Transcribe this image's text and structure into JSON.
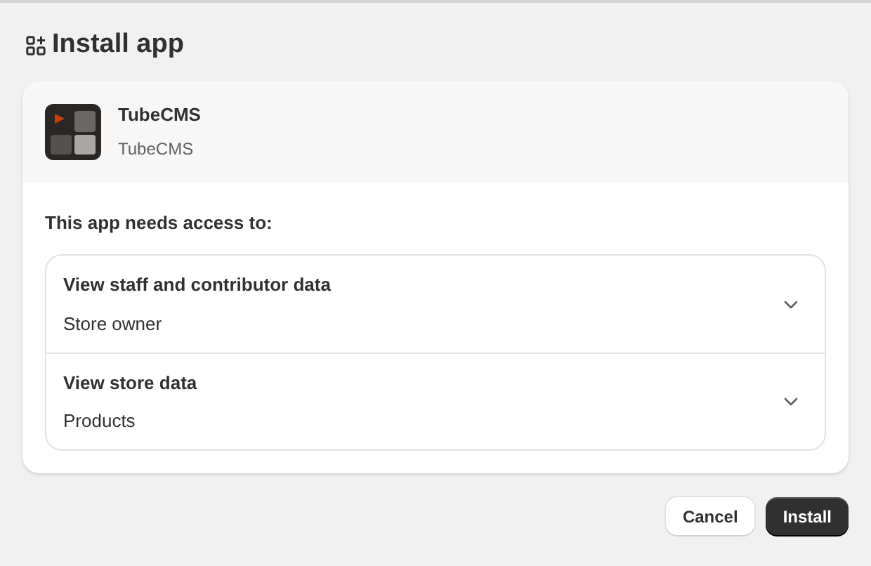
{
  "page_title": "Install app",
  "app": {
    "name": "TubeCMS",
    "developer": "TubeCMS"
  },
  "access_heading": "This app needs access to:",
  "permissions": [
    {
      "title": "View staff and contributor data",
      "detail": "Store owner",
      "expanded": false
    },
    {
      "title": "View store data",
      "detail": "Products",
      "expanded": false
    }
  ],
  "buttons": [
    {
      "label": "Cancel",
      "kind": "secondary"
    },
    {
      "label": "Install",
      "kind": "primary"
    }
  ]
}
